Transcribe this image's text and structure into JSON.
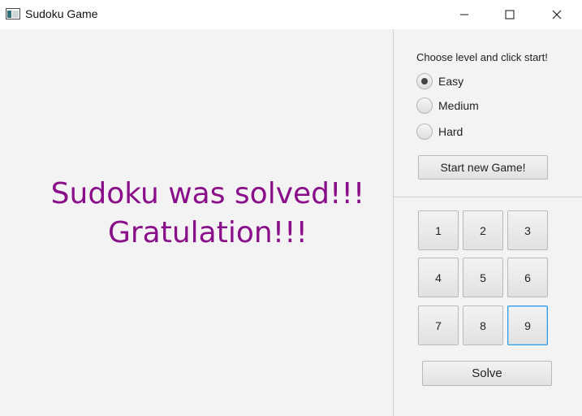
{
  "window": {
    "title": "Sudoku Game",
    "icon": "app-window-icon",
    "controls": [
      "minimize-icon",
      "maximize-icon",
      "close-icon"
    ]
  },
  "main": {
    "message_line1": "Sudoku was solved!!!",
    "message_line2": "Gratulation!!!",
    "message_color": "#8a0e8a"
  },
  "side": {
    "level_prompt": "Choose level and click start!",
    "levels": [
      {
        "label": "Easy",
        "checked": true
      },
      {
        "label": "Medium",
        "checked": false
      },
      {
        "label": "Hard",
        "checked": false
      }
    ],
    "start_label": "Start new Game!",
    "number_buttons": [
      "1",
      "2",
      "3",
      "4",
      "5",
      "6",
      "7",
      "8",
      "9"
    ],
    "focused_number": "9",
    "solve_label": "Solve"
  },
  "colors": {
    "focus_border": "#2f9ae3",
    "background": "#f3f3f3"
  }
}
